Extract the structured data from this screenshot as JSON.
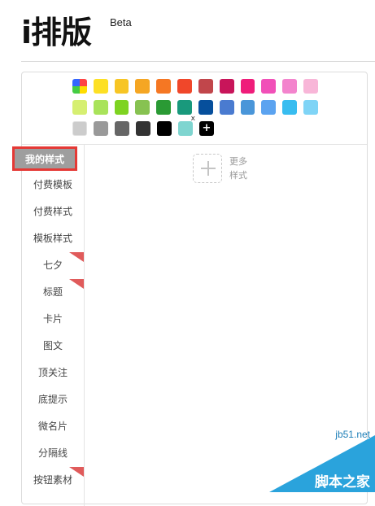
{
  "header": {
    "logo": "i排版",
    "beta": "Beta"
  },
  "palette": {
    "rows": [
      [
        "rainbow",
        "#fde024",
        "#f7c524",
        "#f5a623",
        "#f57723",
        "#f0472a",
        "#c1464b",
        "#c8155a",
        "#ef1d7a",
        "#f150b8",
        "#f384cd",
        "#f8b6d8"
      ],
      [
        "#d6ef71",
        "#a9e35a",
        "#7ed321",
        "#87c251",
        "#2a9a34",
        "#19997c",
        "#064f9c",
        "#4a7bd0",
        "#4a96d9",
        "#5ba3f0",
        "#38bdf0",
        "#7fd4f6"
      ],
      [
        "#cccccc",
        "#999999",
        "#666666",
        "#333333",
        "#000000",
        "#7fd5d0"
      ]
    ],
    "close_symbol": "x",
    "add_symbol": "+"
  },
  "sidebar": {
    "items": [
      {
        "label": "我的样式",
        "active": true,
        "tag": false
      },
      {
        "label": "付费模板",
        "active": false,
        "tag": false
      },
      {
        "label": "付费样式",
        "active": false,
        "tag": false
      },
      {
        "label": "模板样式",
        "active": false,
        "tag": false
      },
      {
        "label": "七夕",
        "active": false,
        "tag": true
      },
      {
        "label": "标题",
        "active": false,
        "tag": true
      },
      {
        "label": "卡片",
        "active": false,
        "tag": false
      },
      {
        "label": "图文",
        "active": false,
        "tag": false
      },
      {
        "label": "顶关注",
        "active": false,
        "tag": false
      },
      {
        "label": "底提示",
        "active": false,
        "tag": false
      },
      {
        "label": "微名片",
        "active": false,
        "tag": false
      },
      {
        "label": "分隔线",
        "active": false,
        "tag": false
      },
      {
        "label": "按钮素材",
        "active": false,
        "tag": true
      }
    ]
  },
  "content": {
    "add_more_label": "更多样式"
  },
  "watermark": {
    "site": "jb51.net",
    "name": "脚本之家"
  }
}
